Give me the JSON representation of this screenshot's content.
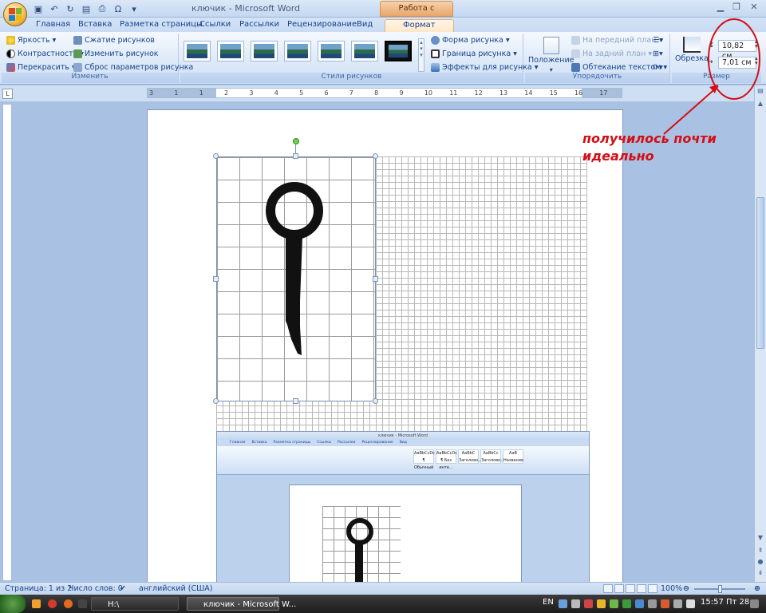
{
  "window": {
    "title": "ключик - Microsoft Word",
    "context_tab": "Работа с рисунками"
  },
  "tabs": [
    "Главная",
    "Вставка",
    "Разметка страницы",
    "Ссылки",
    "Рассылки",
    "Рецензирование",
    "Вид",
    "Формат"
  ],
  "ribbon": {
    "adjust": {
      "label": "Изменить",
      "brightness": "Яркость",
      "contrast": "Контрастность",
      "recolor": "Перекрасить",
      "compress": "Сжатие рисунков",
      "change": "Изменить рисунок",
      "reset": "Сброс параметров рисунка"
    },
    "styles": {
      "label": "Стили рисунков",
      "shape": "Форма рисунка",
      "border": "Граница рисунка",
      "effects": "Эффекты для рисунка"
    },
    "arrange": {
      "label": "Упорядочить",
      "position": "Положение",
      "bring_front": "На передний план",
      "send_back": "На задний план",
      "wrap": "Обтекание текстом"
    },
    "size": {
      "label": "Размер",
      "crop": "Обрезка",
      "height": "10,82 см",
      "width": "7,01 см"
    }
  },
  "ruler": {
    "numbers": [
      "3",
      "1",
      "1",
      "2",
      "3",
      "4",
      "5",
      "6",
      "7",
      "8",
      "9",
      "10",
      "11",
      "12",
      "13",
      "14",
      "15",
      "16",
      "17"
    ]
  },
  "annotation": {
    "line1": "получилось почти",
    "line2": "идеально",
    "color": "#d40e14"
  },
  "inner_screenshot": {
    "title": "ключик - Microsoft Word",
    "tabs": [
      "Главная",
      "Вставка",
      "Разметка страницы",
      "Ссылки",
      "Рассылки",
      "Рецензирование",
      "Вид"
    ],
    "styles": [
      "AaBbCcDc",
      "AaBbCcDc",
      "AaBbC",
      "AaBbCc",
      "AaB"
    ],
    "style_names": [
      "¶ Обычный",
      "¶ Без инте...",
      "Заголово...",
      "Заголово...",
      "Название"
    ]
  },
  "status": {
    "page": "Страница: 1 из 2",
    "words": "Число слов: 0",
    "language": "английский (США)",
    "zoom": "100%"
  },
  "taskbar": {
    "tasks": [
      "H:\\",
      "ключик - Microsoft W..."
    ],
    "lang": "EN",
    "clock": "15:57 Пт 28"
  }
}
